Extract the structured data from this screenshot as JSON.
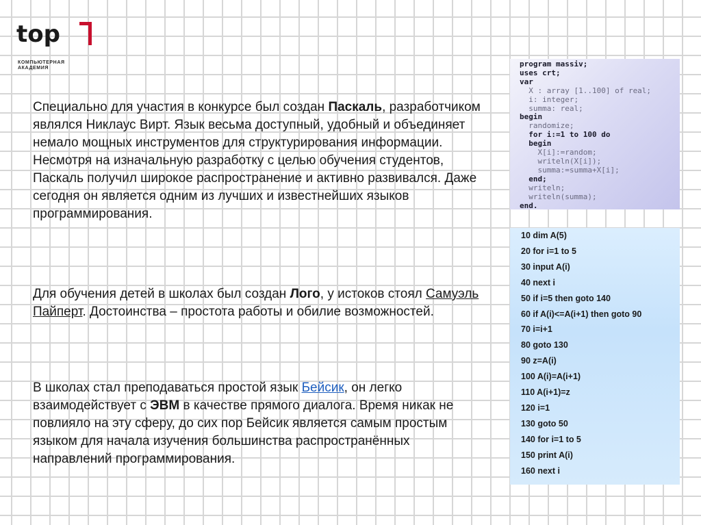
{
  "logo": {
    "word": "top",
    "subtitle_line1": "компьютерная",
    "subtitle_line2": "академия"
  },
  "paragraphs": {
    "p1": {
      "t1": "Специально для участия в конкурсе был создан ",
      "b1": "Паскаль",
      "t2": ", разработчиком являлся Никлаус Вирт. Язык весьма доступный, удобный и объединяет немало мощных инструментов для структурирования информации. Несмотря на изначальную разработку с целью обучения студентов, Паскаль получил широкое распространение и активно развивался. Даже сегодня он является одним из лучших и известнейших языков программирования."
    },
    "p2": {
      "t1": "Для обучения детей в школах был создан ",
      "b1": "Лого",
      "t2": ", у истоков стоял ",
      "link": "Самуэль Пайперт",
      "t3": ". Достоинства – простота работы и обилие возможностей."
    },
    "p3": {
      "t1": "В школах стал преподаваться простой язык ",
      "link": "Бейсик",
      "t2": ", он легко взаимодействует с ",
      "b1": "ЭВМ",
      "t3": " в качестве прямого диалога. Время никак не повлияло на эту сферу, до сих пор Бейсик является самым простым языком для начала изучения большинства распространённых направлений программирования."
    }
  },
  "code_pascal": {
    "lines": [
      {
        "text": "program massiv;",
        "kw": true
      },
      {
        "text": "uses crt;",
        "kw": true
      },
      {
        "text": "var",
        "kw": true
      },
      {
        "text": "  X : array [1..100] of real;",
        "kw": false
      },
      {
        "text": "  i: integer;",
        "kw": false
      },
      {
        "text": "  summa: real;",
        "kw": false
      },
      {
        "text": "begin",
        "kw": true
      },
      {
        "text": "  randomize;",
        "kw": false
      },
      {
        "text": "  for i:=1 to 100 do",
        "kw": true
      },
      {
        "text": "  begin",
        "kw": true
      },
      {
        "text": "    X[i]:=random;",
        "kw": false
      },
      {
        "text": "    writeln(X[i]);",
        "kw": false
      },
      {
        "text": "    summa:=summa+X[i];",
        "kw": false
      },
      {
        "text": "  end;",
        "kw": true
      },
      {
        "text": "  writeln;",
        "kw": false
      },
      {
        "text": "  writeln(summa);",
        "kw": false
      },
      {
        "text": "end.",
        "kw": true
      }
    ]
  },
  "code_basic": {
    "lines": [
      "10 dim A(5)",
      "20 for i=1 to 5",
      "30 input A(i)",
      "40 next i",
      "50 if i=5 then goto 140",
      "60 if A(i)<=A(i+1) then goto 90",
      "70 i=i+1",
      "80 goto 130",
      "90 z=A(i)",
      "100 A(i)=A(i+1)",
      "110 A(i+1)=z",
      "120 i=1",
      "130 goto 50",
      "140 for i=1 to 5",
      "150 print A(i)",
      "160 next i"
    ]
  }
}
